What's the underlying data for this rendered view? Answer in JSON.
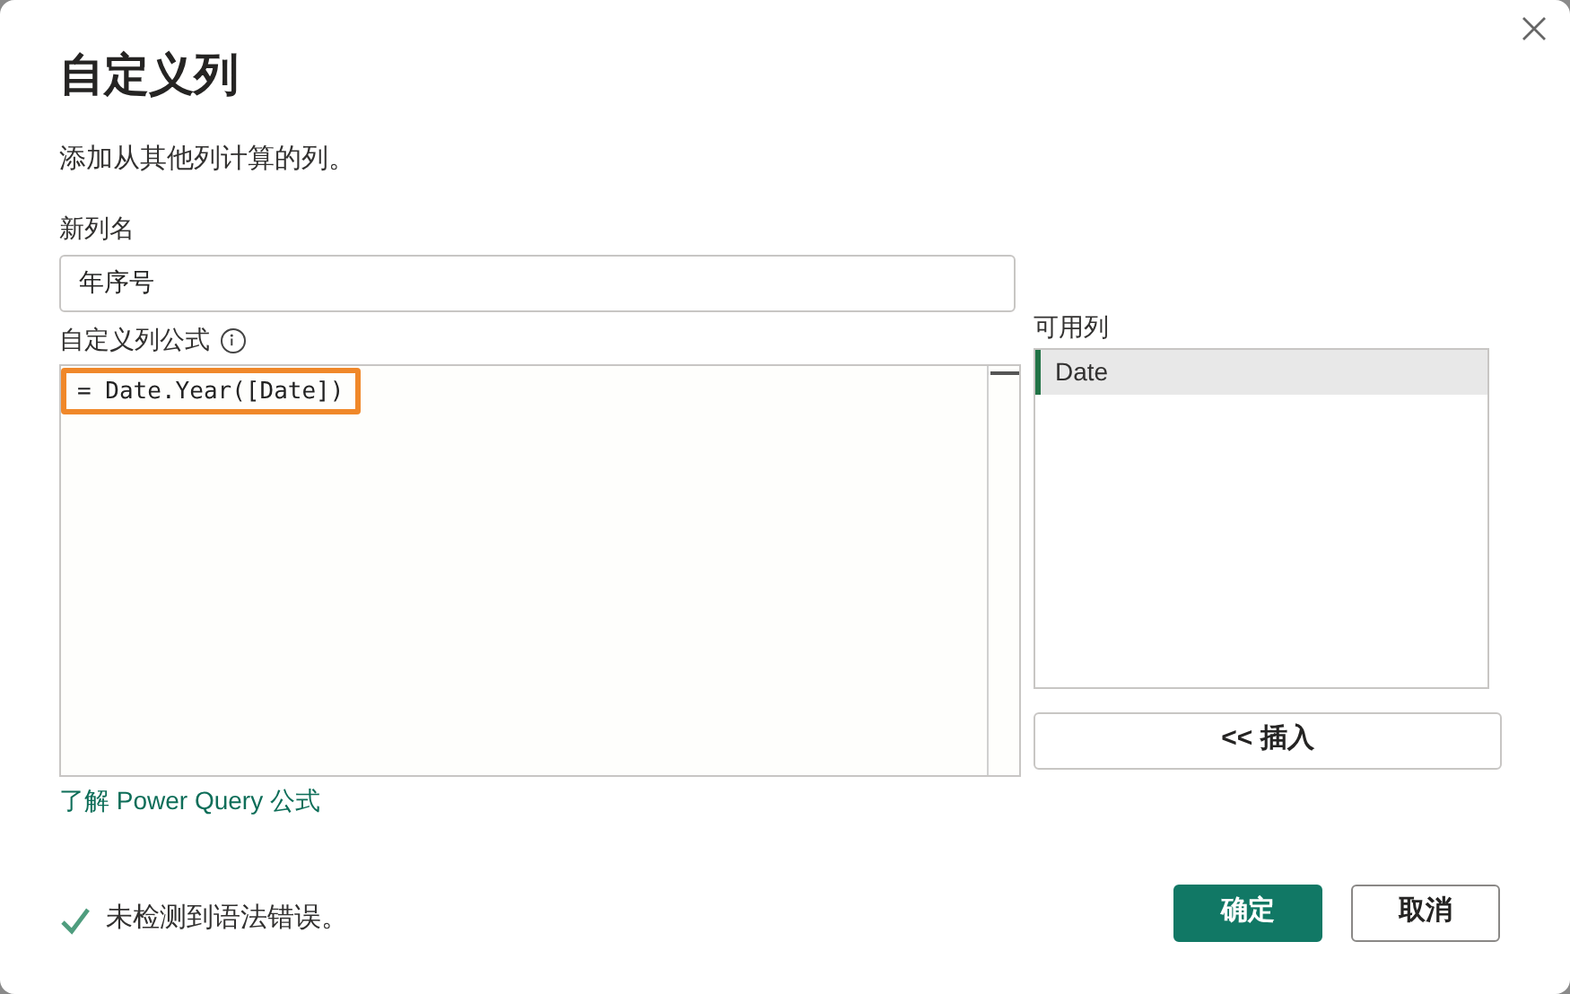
{
  "dialog": {
    "title": "自定义列",
    "description": "添加从其他列计算的列。"
  },
  "new_column_name": {
    "label": "新列名",
    "value": "年序号"
  },
  "formula": {
    "label": "自定义列公式",
    "value": "= Date.Year([Date])",
    "highlighted": true
  },
  "available_columns": {
    "label": "可用列",
    "items": [
      {
        "label": "Date",
        "selected": true
      }
    ]
  },
  "insert_button": "<< 插入",
  "help_link": "了解 Power Query 公式",
  "status": {
    "ok": true,
    "text": "未检测到语法错误。"
  },
  "buttons": [
    {
      "label": "确定",
      "kind": "primary"
    },
    {
      "label": "取消",
      "kind": "secondary"
    }
  ]
}
